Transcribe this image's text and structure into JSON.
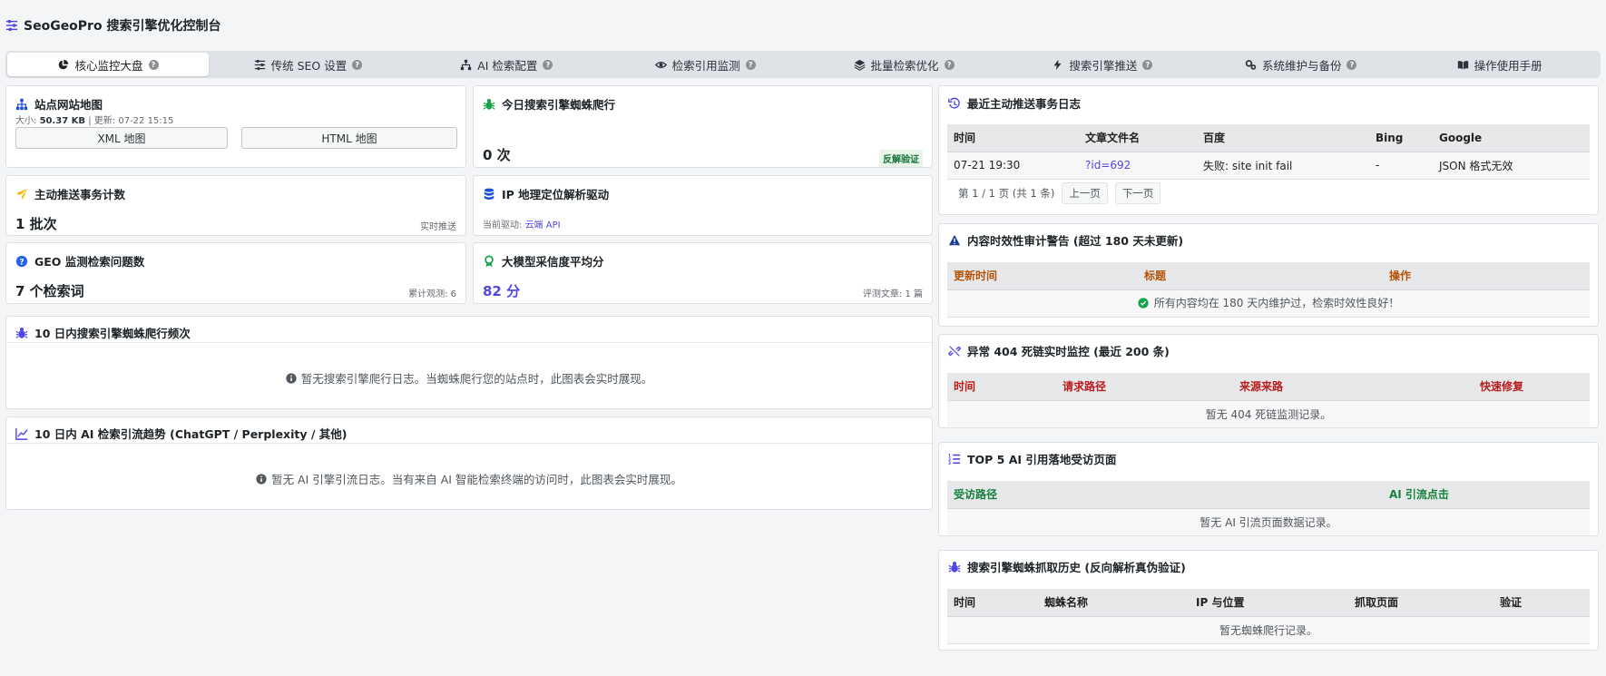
{
  "app": {
    "title": "SeoGeoPro 搜索引擎优化控制台"
  },
  "tabs": [
    {
      "label": "核心监控大盘",
      "icon": "pie-chart-icon"
    },
    {
      "label": "传统 SEO 设置",
      "icon": "sliders-icon"
    },
    {
      "label": "AI 检索配置",
      "icon": "sitemap-icon"
    },
    {
      "label": "检索引用监测",
      "icon": "eye-icon"
    },
    {
      "label": "批量检索优化",
      "icon": "layers-icon"
    },
    {
      "label": "搜索引擎推送",
      "icon": "bolt-icon"
    },
    {
      "label": "系统维护与备份",
      "icon": "gears-icon"
    },
    {
      "label": "操作使用手册",
      "icon": "book-icon"
    }
  ],
  "sitemap": {
    "title": "站点网站地图",
    "meta_prefix": "大小:",
    "size": "50.37 KB",
    "meta_suffix": "| 更新: 07-22 15:15",
    "xml_button": "XML 地图",
    "html_button": "HTML 地图"
  },
  "spider_today": {
    "title": "今日搜索引擎蜘蛛爬行",
    "value": "0 次",
    "badge": "反解验证"
  },
  "push_count": {
    "title": "主动推送事务计数",
    "value": "1 批次",
    "note": "实时推送"
  },
  "ip_driver": {
    "title": "IP 地理定位解析驱动",
    "label": "当前驱动:",
    "value": "云端 API"
  },
  "geo_questions": {
    "title": "GEO 监测检索问题数",
    "value": "7 个检索词",
    "note": "累计观测: 6"
  },
  "llm_score": {
    "title": "大模型采信度平均分",
    "value": "82 分",
    "note": "评测文章: 1 篇"
  },
  "spider_freq": {
    "title": "10 日内搜索引擎蜘蛛爬行频次",
    "empty": "暂无搜索引擎爬行日志。当蜘蛛爬行您的站点时，此图表会实时展现。"
  },
  "ai_trend": {
    "title": "10 日内 AI 检索引流趋势 (ChatGPT / Perplexity / 其他)",
    "empty": "暂无 AI 引擎引流日志。当有来自 AI 智能检索终端的访问时，此图表会实时展现。"
  },
  "push_log": {
    "title": "最近主动推送事务日志",
    "headers": [
      "时间",
      "文章文件名",
      "百度",
      "Bing",
      "Google"
    ],
    "rows": [
      [
        "07-21 19:30",
        "?id=692",
        "失败: site init fail",
        "-",
        "JSON 格式无效"
      ]
    ],
    "pager_text": "第 1 / 1 页 (共 1 条)",
    "prev": "上一页",
    "next": "下一页"
  },
  "stale_audit": {
    "title": "内容时效性审计警告 (超过 180 天未更新)",
    "headers": [
      "更新时间",
      "标题",
      "操作"
    ],
    "empty": "所有内容均在 180 天内维护过，检索时效性良好！"
  },
  "dead_links": {
    "title": "异常 404 死链实时监控 (最近 200 条)",
    "headers": [
      "时间",
      "请求路径",
      "来源来路",
      "快速修复"
    ],
    "empty": "暂无 404 死链监测记录。"
  },
  "top_ai_pages": {
    "title": "TOP 5 AI 引用落地受访页面",
    "headers": [
      "受访路径",
      "AI 引流点击"
    ],
    "empty": "暂无 AI 引流页面数据记录。"
  },
  "spider_history": {
    "title": "搜索引擎蜘蛛抓取历史 (反向解析真伪验证)",
    "headers": [
      "时间",
      "蜘蛛名称",
      "IP 与位置",
      "抓取页面",
      "验证"
    ],
    "empty": "暂无蜘蛛爬行记录。"
  },
  "colors": {
    "accent": "#4f46e5",
    "green": "#15803d",
    "orange": "#b45309",
    "red": "#b91c1c"
  }
}
